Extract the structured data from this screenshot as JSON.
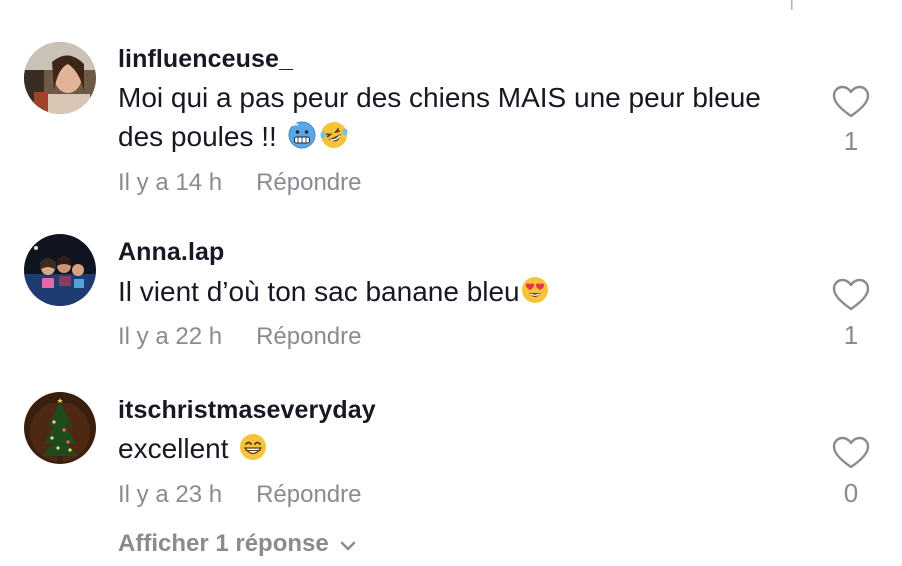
{
  "comments": [
    {
      "username": "linfluenceuse_",
      "text_line1": "Moi qui a pas peur des chiens MAIS une peur bleue",
      "text_line2": "des poules !!",
      "emojis": [
        "cold-face-emoji",
        "rolling-laughing-emoji"
      ],
      "time": "Il y a 14 h",
      "reply_label": "Répondre",
      "like_count": "1"
    },
    {
      "username": "Anna.lap",
      "text": "Il vient d’où ton sac banane bleu",
      "emojis": [
        "heart-eyes-emoji"
      ],
      "time": "Il y a 22 h",
      "reply_label": "Répondre",
      "like_count": "1"
    },
    {
      "username": "itschristmaseveryday",
      "text": "excellent",
      "emojis": [
        "grinning-emoji"
      ],
      "time": "Il y a 23 h",
      "reply_label": "Répondre",
      "like_count": "0"
    }
  ],
  "show_replies_label": "Afficher 1 réponse",
  "colors": {
    "text": "#161823",
    "muted": "#8a8b91",
    "background": "#ffffff"
  }
}
